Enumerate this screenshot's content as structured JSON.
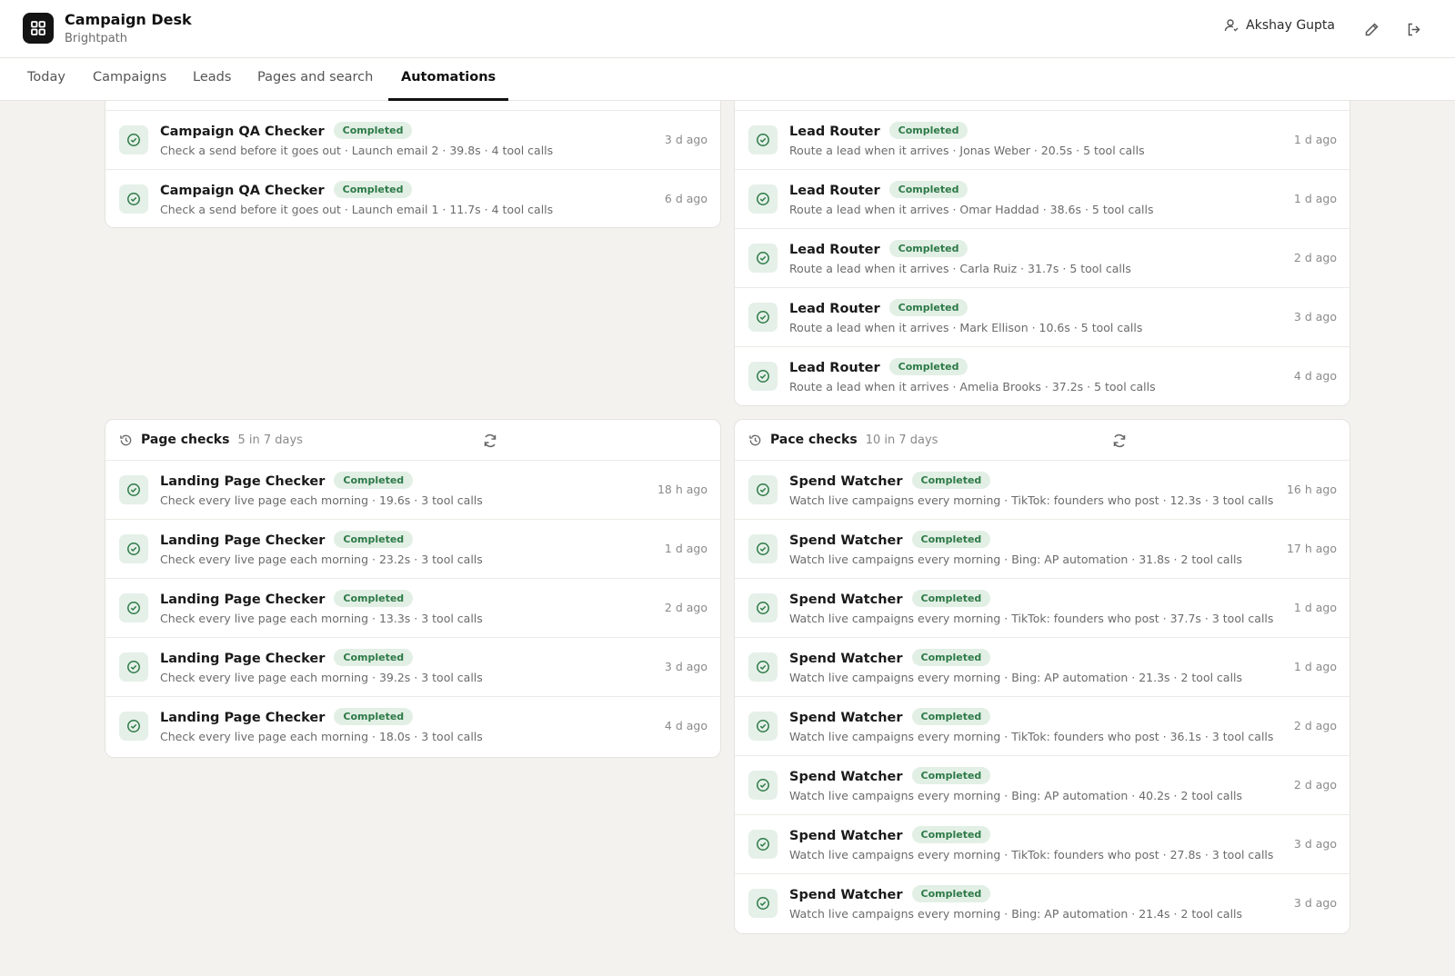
{
  "app": {
    "title": "Campaign Desk",
    "subtitle": "Brightpath",
    "user_name": "Akshay Gupta"
  },
  "tabs": [
    {
      "label": "Today"
    },
    {
      "label": "Campaigns"
    },
    {
      "label": "Leads"
    },
    {
      "label": "Pages and search"
    },
    {
      "label": "Automations",
      "active": true
    }
  ],
  "colors": {
    "accent": "#111111",
    "success_bg": "#e2efe5",
    "success_text": "#2d7a47"
  },
  "status_label": "Completed",
  "campaign_qa": {
    "rows": [
      {
        "name": "Campaign QA Checker",
        "desc": "Check a send before it goes out · Launch email 2 · 39.8s · 4 tool calls",
        "time": "3 d ago"
      },
      {
        "name": "Campaign QA Checker",
        "desc": "Check a send before it goes out · Launch email 1 · 11.7s · 4 tool calls",
        "time": "6 d ago"
      }
    ]
  },
  "lead_router": {
    "rows": [
      {
        "name": "Lead Router",
        "desc": "Route a lead when it arrives · Jonas Weber · 20.5s · 5 tool calls",
        "time": "1 d ago"
      },
      {
        "name": "Lead Router",
        "desc": "Route a lead when it arrives · Omar Haddad · 38.6s · 5 tool calls",
        "time": "1 d ago"
      },
      {
        "name": "Lead Router",
        "desc": "Route a lead when it arrives · Carla Ruiz · 31.7s · 5 tool calls",
        "time": "2 d ago"
      },
      {
        "name": "Lead Router",
        "desc": "Route a lead when it arrives · Mark Ellison · 10.6s · 5 tool calls",
        "time": "3 d ago"
      },
      {
        "name": "Lead Router",
        "desc": "Route a lead when it arrives · Amelia Brooks · 37.2s · 5 tool calls",
        "time": "4 d ago"
      }
    ]
  },
  "page_checks": {
    "title": "Page checks",
    "count": "5 in 7 days",
    "rows": [
      {
        "name": "Landing Page Checker",
        "desc": "Check every live page each morning · 19.6s · 3 tool calls",
        "time": "18 h ago"
      },
      {
        "name": "Landing Page Checker",
        "desc": "Check every live page each morning · 23.2s · 3 tool calls",
        "time": "1 d ago"
      },
      {
        "name": "Landing Page Checker",
        "desc": "Check every live page each morning · 13.3s · 3 tool calls",
        "time": "2 d ago"
      },
      {
        "name": "Landing Page Checker",
        "desc": "Check every live page each morning · 39.2s · 3 tool calls",
        "time": "3 d ago"
      },
      {
        "name": "Landing Page Checker",
        "desc": "Check every live page each morning · 18.0s · 3 tool calls",
        "time": "4 d ago"
      }
    ]
  },
  "pace_checks": {
    "title": "Pace checks",
    "count": "10 in 7 days",
    "rows": [
      {
        "name": "Spend Watcher",
        "desc": "Watch live campaigns every morning · TikTok: founders who post · 12.3s · 3 tool calls",
        "time": "16 h ago"
      },
      {
        "name": "Spend Watcher",
        "desc": "Watch live campaigns every morning · Bing: AP automation · 31.8s · 2 tool calls",
        "time": "17 h ago"
      },
      {
        "name": "Spend Watcher",
        "desc": "Watch live campaigns every morning · TikTok: founders who post · 37.7s · 3 tool calls",
        "time": "1 d ago"
      },
      {
        "name": "Spend Watcher",
        "desc": "Watch live campaigns every morning · Bing: AP automation · 21.3s · 2 tool calls",
        "time": "1 d ago"
      },
      {
        "name": "Spend Watcher",
        "desc": "Watch live campaigns every morning · TikTok: founders who post · 36.1s · 3 tool calls",
        "time": "2 d ago"
      },
      {
        "name": "Spend Watcher",
        "desc": "Watch live campaigns every morning · Bing: AP automation · 40.2s · 2 tool calls",
        "time": "2 d ago"
      },
      {
        "name": "Spend Watcher",
        "desc": "Watch live campaigns every morning · TikTok: founders who post · 27.8s · 3 tool calls",
        "time": "3 d ago"
      },
      {
        "name": "Spend Watcher",
        "desc": "Watch live campaigns every morning · Bing: AP automation · 21.4s · 2 tool calls",
        "time": "3 d ago"
      }
    ]
  }
}
